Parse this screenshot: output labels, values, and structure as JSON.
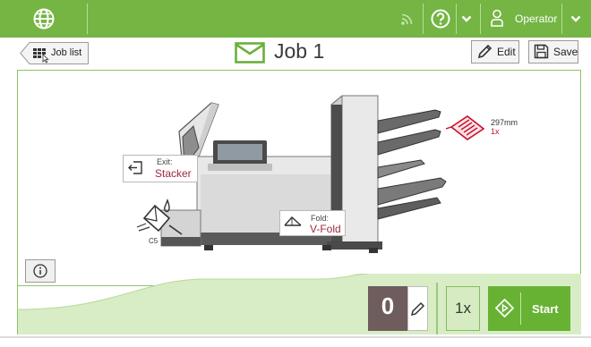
{
  "topbar": {
    "operator_label": "Operator",
    "icons": [
      "globe-icon",
      "signal-icon",
      "help-icon",
      "chevron-down-icon",
      "user-icon",
      "chevron-down-icon"
    ]
  },
  "header": {
    "back_label": "Job list",
    "title": "Job 1",
    "edit_label": "Edit",
    "save_label": "Save"
  },
  "machine": {
    "exit": {
      "label": "Exit:",
      "value": "Stacker"
    },
    "fold": {
      "label": "Fold:",
      "value": "V-Fold"
    },
    "envelope": {
      "size": "C5"
    },
    "document": {
      "size": "297mm",
      "count": "1x"
    }
  },
  "bottom": {
    "counter": "0",
    "quantity": "1x",
    "start_label": "Start"
  },
  "colors": {
    "brand_green": "#74b543",
    "start_green": "#67b233",
    "light_green": "#d7ebc3",
    "counter_bg": "#6e5d5c",
    "accent_red": "#c4102a",
    "value_red": "#9c2a3a"
  }
}
